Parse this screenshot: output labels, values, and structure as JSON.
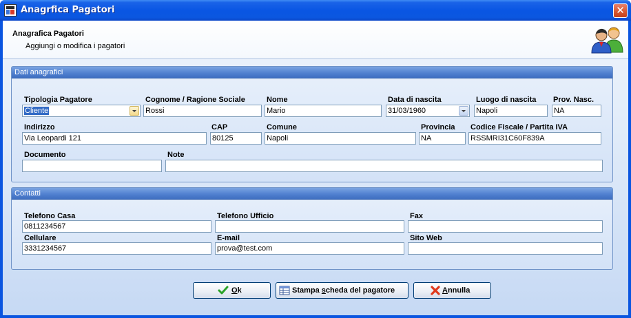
{
  "window": {
    "title": "Anagrfica Pagatori",
    "close_glyph": "✕"
  },
  "header": {
    "title": "Anagrafica Pagatori",
    "subtitle": "Aggiungi o modifica i pagatori",
    "icon": "users-icon"
  },
  "dati": {
    "group_title": "Dati anagrafici",
    "tipologia": {
      "label": "Tipologia Pagatore",
      "value": "Cliente"
    },
    "cognome": {
      "label": "Cognome / Ragione Sociale",
      "value": "Rossi"
    },
    "nome": {
      "label": "Nome",
      "value": "Mario"
    },
    "data_nascita": {
      "label": "Data di nascita",
      "value": "31/03/1960"
    },
    "luogo_nascita": {
      "label": "Luogo di nascita",
      "value": "Napoli"
    },
    "prov_nasc": {
      "label": "Prov. Nasc.",
      "value": "NA"
    },
    "indirizzo": {
      "label": "Indirizzo",
      "value": "Via Leopardi 121"
    },
    "cap": {
      "label": "CAP",
      "value": "80125"
    },
    "comune": {
      "label": "Comune",
      "value": "Napoli"
    },
    "provincia": {
      "label": "Provincia",
      "value": "NA"
    },
    "codice_fiscale": {
      "label": "Codice Fiscale / Partita IVA",
      "value": "RSSMRI31C60F839A"
    },
    "documento": {
      "label": "Documento",
      "value": ""
    },
    "note": {
      "label": "Note",
      "value": ""
    }
  },
  "contatti": {
    "group_title": "Contatti",
    "tel_casa": {
      "label": "Telefono Casa",
      "value": "0811234567"
    },
    "tel_ufficio": {
      "label": "Telefono Ufficio",
      "value": ""
    },
    "fax": {
      "label": "Fax",
      "value": ""
    },
    "cellulare": {
      "label": "Cellulare",
      "value": "3331234567"
    },
    "email": {
      "label": "E-mail",
      "value": "prova@test.com"
    },
    "sito_web": {
      "label": "Sito Web",
      "value": ""
    }
  },
  "buttons": {
    "ok": {
      "underline": "O",
      "rest": "k"
    },
    "stampa": {
      "before": "Stampa ",
      "underline": "s",
      "after": "cheda del pagatore"
    },
    "annulla": {
      "underline": "A",
      "rest": "nnulla"
    }
  },
  "colors": {
    "titlebar": "#0a56e3",
    "group_header": "#4f7fcf",
    "selection": "#316ac5",
    "ok_check": "#2aa32a",
    "cancel_x": "#e03a1e"
  }
}
